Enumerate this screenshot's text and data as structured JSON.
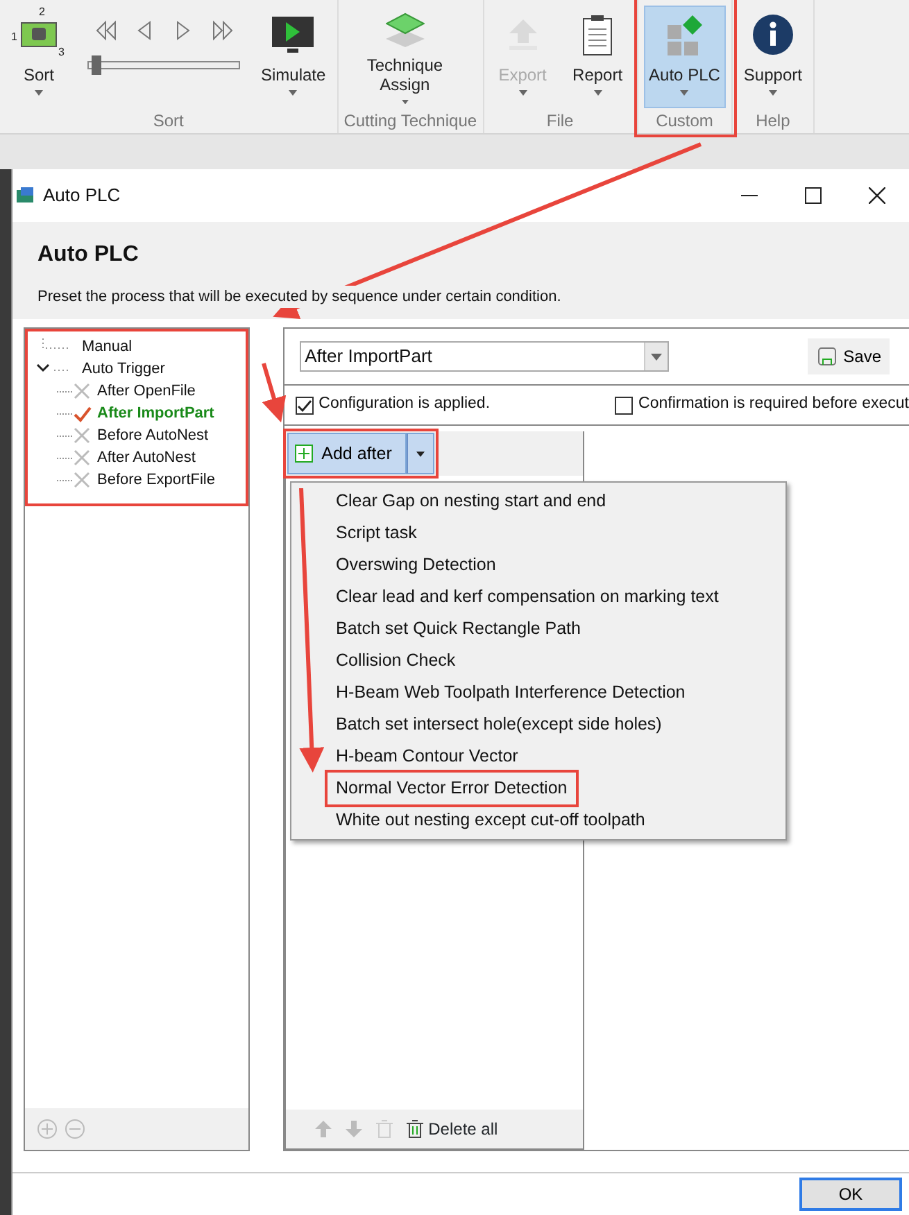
{
  "ribbon": {
    "groups": [
      {
        "label": "Sort",
        "kind": "sort",
        "highlighted": false,
        "buttons": [
          {
            "label": "Sort",
            "has_menu": true,
            "disabled": false,
            "selected": false,
            "icon_labels": [
              "1",
              "2",
              "3"
            ]
          },
          {
            "label": "Simulate",
            "has_menu": true,
            "disabled": false,
            "selected": false
          }
        ],
        "slider": {
          "level": 0.02
        }
      },
      {
        "label": "Cutting Technique",
        "kind": "plain",
        "highlighted": false,
        "buttons": [
          {
            "label": "Technique Assign",
            "has_menu": true,
            "disabled": false,
            "selected": false
          }
        ]
      },
      {
        "label": "File",
        "kind": "plain",
        "highlighted": false,
        "buttons": [
          {
            "label": "Export",
            "has_menu": true,
            "disabled": true,
            "selected": false
          },
          {
            "label": "Report",
            "has_menu": true,
            "disabled": false,
            "selected": false
          }
        ]
      },
      {
        "label": "Custom",
        "kind": "plain",
        "highlighted": true,
        "buttons": [
          {
            "label": "Auto PLC",
            "has_menu": true,
            "disabled": false,
            "selected": true
          }
        ]
      },
      {
        "label": "Help",
        "kind": "plain",
        "highlighted": false,
        "buttons": [
          {
            "label": "Support",
            "has_menu": true,
            "disabled": false,
            "selected": false
          }
        ]
      }
    ]
  },
  "dialog": {
    "title": "Auto PLC",
    "heading": "Auto PLC",
    "description": "Preset the process that will be executed by sequence under certain condition.",
    "tree": {
      "highlighted": true,
      "items": [
        {
          "label": "Manual",
          "expanded": false
        },
        {
          "label": "Auto Trigger",
          "expanded": true,
          "children": [
            {
              "label": "After OpenFile",
              "active": false
            },
            {
              "label": "After ImportPart",
              "active": true
            },
            {
              "label": "Before AutoNest",
              "active": false
            },
            {
              "label": "After AutoNest",
              "active": false
            },
            {
              "label": "Before ExportFile",
              "active": false
            }
          ]
        }
      ]
    },
    "trigger_select": {
      "value": "After ImportPart"
    },
    "save_button": "Save",
    "options": [
      {
        "label": "Configuration is applied.",
        "checked": true
      },
      {
        "label": "Confirmation is required before execut",
        "checked": false
      }
    ],
    "add_button": {
      "label": "Add after",
      "highlighted": true
    },
    "menu": [
      {
        "label": "Clear Gap on nesting start and end",
        "highlighted": false
      },
      {
        "label": "Script task",
        "highlighted": false
      },
      {
        "label": "Overswing Detection",
        "highlighted": false
      },
      {
        "label": "Clear lead and kerf compensation on marking text",
        "highlighted": false
      },
      {
        "label": "Batch set Quick Rectangle Path",
        "highlighted": false
      },
      {
        "label": "Collision Check",
        "highlighted": false
      },
      {
        "label": "H-Beam Web Toolpath Interference Detection",
        "highlighted": false
      },
      {
        "label": "Batch set intersect hole(except side holes)",
        "highlighted": false
      },
      {
        "label": "H-beam Contour Vector",
        "highlighted": false
      },
      {
        "label": "Normal Vector Error Detection",
        "highlighted": true
      },
      {
        "label": "White out nesting except cut-off toolpath",
        "highlighted": false
      }
    ],
    "delete_all": "Delete all",
    "ok_button": "OK"
  }
}
